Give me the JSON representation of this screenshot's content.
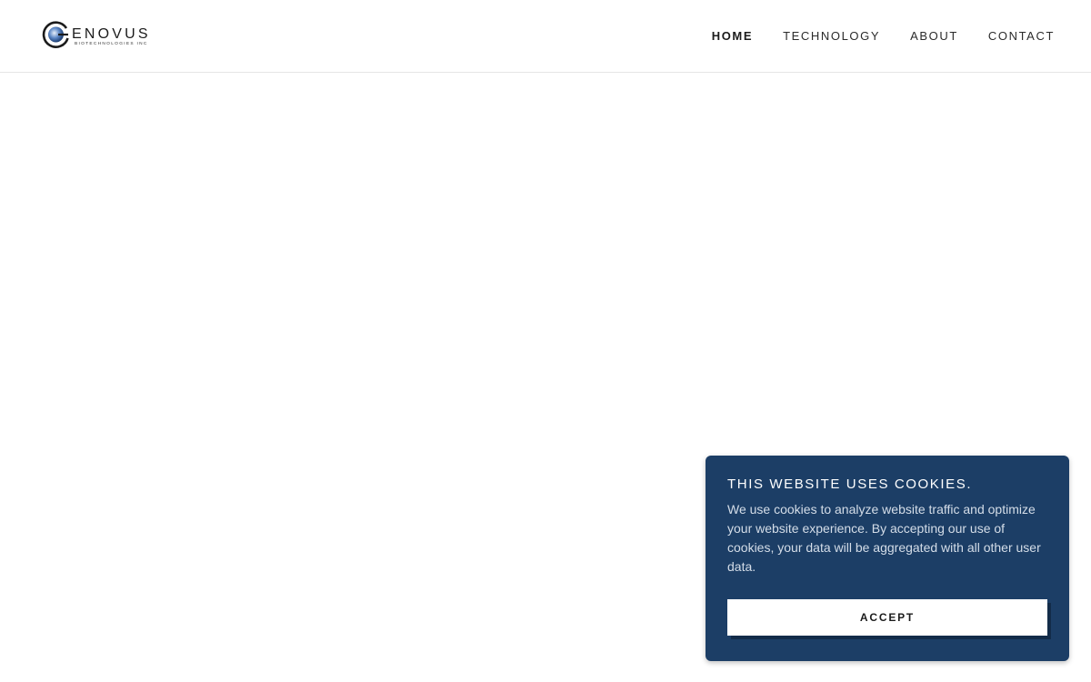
{
  "brand": {
    "name": "ENOVUS",
    "tagline": "BIOTECHNOLOGIES INC"
  },
  "nav": {
    "items": [
      {
        "label": "HOME",
        "active": true
      },
      {
        "label": "TECHNOLOGY",
        "active": false
      },
      {
        "label": "ABOUT",
        "active": false
      },
      {
        "label": "CONTACT",
        "active": false
      }
    ]
  },
  "cookie_banner": {
    "title": "THIS WEBSITE USES COOKIES.",
    "body": "We use cookies to analyze website traffic and optimize your website experience. By accepting our use of cookies, your data will be aggregated with all other user data.",
    "accept_label": "ACCEPT",
    "background_color": "#1c3e66"
  }
}
